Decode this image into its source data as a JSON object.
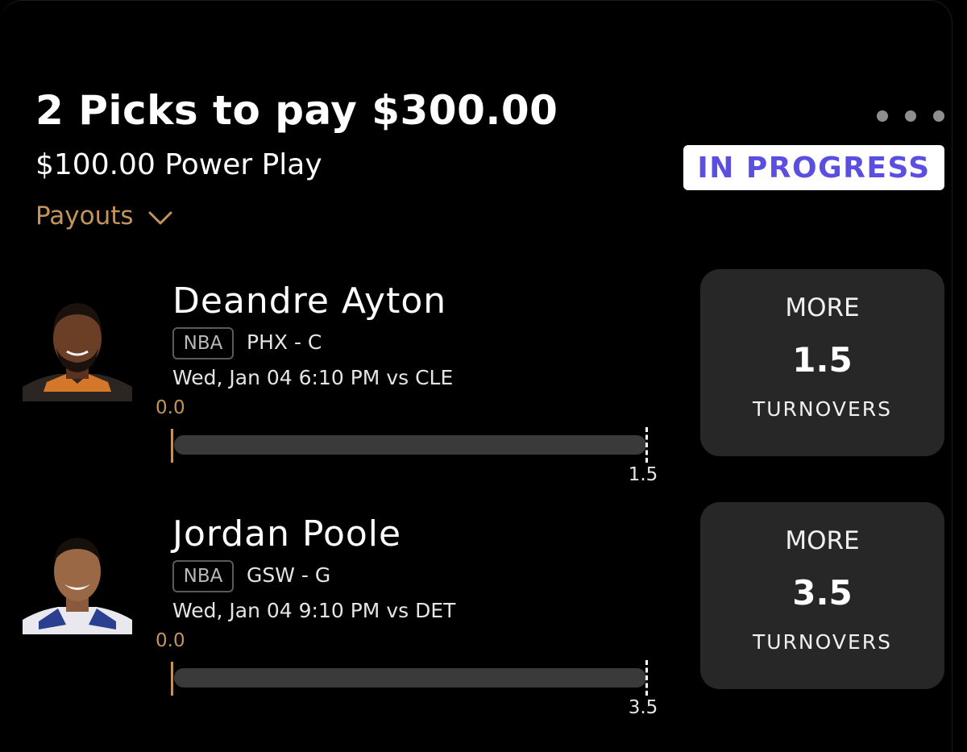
{
  "header": {
    "title": "2 Picks to pay $300.00",
    "subtitle": "$100.00 Power Play",
    "payouts_label": "Payouts",
    "status": "IN PROGRESS"
  },
  "colors": {
    "background": "#000000",
    "accent_gold": "#c4955a",
    "status_text": "#5a4fe0",
    "card_bg": "#272727",
    "progress_track": "#3a3a3a"
  },
  "picks": [
    {
      "player": "Deandre Ayton",
      "league": "NBA",
      "team_position": "PHX - C",
      "game_time": "Wed, Jan 04 6:10 PM  vs CLE",
      "current_value": "0.0",
      "line": "1.5",
      "progress": 0,
      "direction": "MORE",
      "stat": "TURNOVERS",
      "avatar": "player-photo"
    },
    {
      "player": "Jordan Poole",
      "league": "NBA",
      "team_position": "GSW - G",
      "game_time": "Wed, Jan 04 9:10 PM  vs DET",
      "current_value": "0.0",
      "line": "3.5",
      "progress": 0,
      "direction": "MORE",
      "stat": "TURNOVERS",
      "avatar": "player-photo"
    }
  ]
}
